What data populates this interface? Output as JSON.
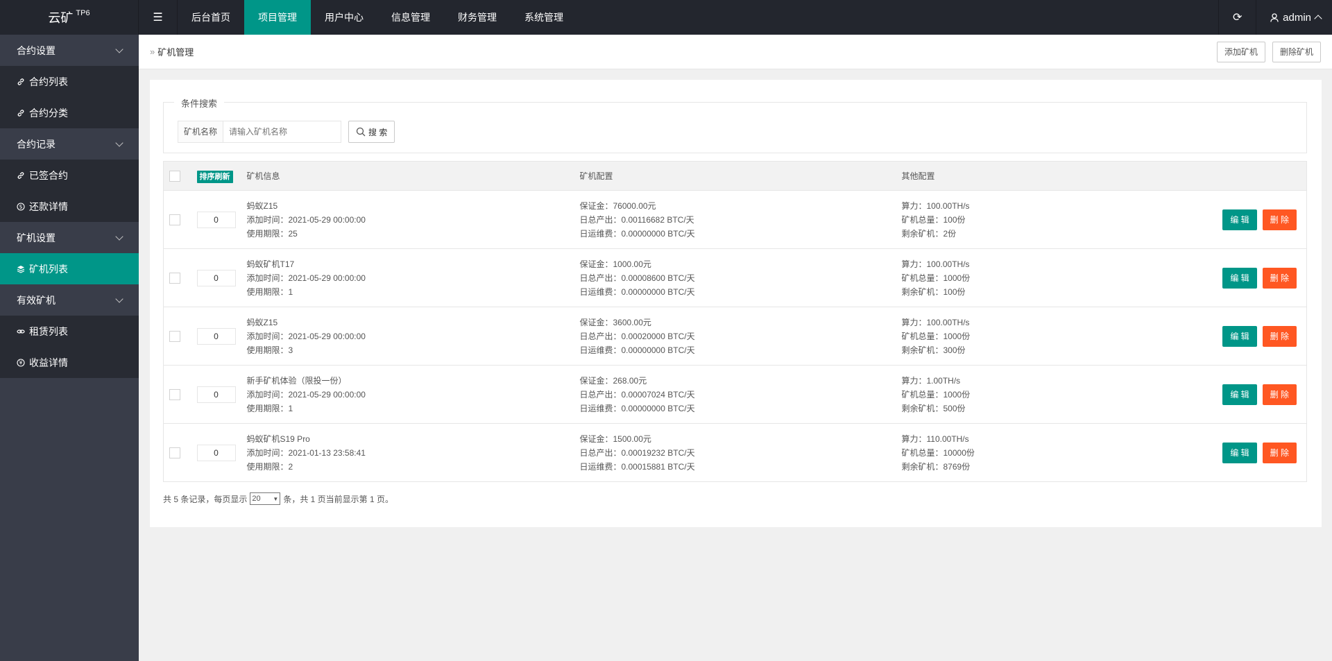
{
  "header": {
    "logo": "云矿",
    "logo_sup": "TP6",
    "nav": [
      "后台首页",
      "项目管理",
      "用户中心",
      "信息管理",
      "财务管理",
      "系统管理"
    ],
    "active_nav": 1,
    "user": "admin"
  },
  "sidebar": {
    "groups": [
      {
        "label": "合约设置",
        "items": [
          {
            "icon": "link-icon",
            "label": "合约列表"
          },
          {
            "icon": "link-icon",
            "label": "合约分类"
          }
        ]
      },
      {
        "label": "合约记录",
        "items": [
          {
            "icon": "link-icon",
            "label": "已签合约"
          },
          {
            "icon": "dollar-icon",
            "label": "还款详情"
          }
        ]
      },
      {
        "label": "矿机设置",
        "items": [
          {
            "icon": "layers-icon",
            "label": "矿机列表"
          }
        ]
      },
      {
        "label": "有效矿机",
        "items": [
          {
            "icon": "chain-icon",
            "label": "租赁列表"
          },
          {
            "icon": "yen-icon",
            "label": "收益详情"
          }
        ]
      }
    ]
  },
  "breadcrumb": "矿机管理",
  "toolbar": {
    "add_label": "添加矿机",
    "delete_label": "删除矿机"
  },
  "search": {
    "legend": "条件搜索",
    "label": "矿机名称",
    "placeholder": "请输入矿机名称",
    "button": "搜 索"
  },
  "table": {
    "headers": {
      "sort": "排序刷新",
      "info": "矿机信息",
      "config": "矿机配置",
      "other": "其他配置"
    },
    "rows": [
      {
        "sort": "0",
        "name": "蚂蚁Z15",
        "added": "添加时间：2021-05-29 00:00:00",
        "period": "使用期限：25",
        "deposit": "保证金：76000.00元",
        "daily": "日总产出：0.00116682 BTC/天",
        "maint": "日运维费：0.00000000 BTC/天",
        "power": "算力：100.00TH/s",
        "total": "矿机总量：100份",
        "remain": "剩余矿机：2份"
      },
      {
        "sort": "0",
        "name": "蚂蚁矿机T17",
        "added": "添加时间：2021-05-29 00:00:00",
        "period": "使用期限：1",
        "deposit": "保证金：1000.00元",
        "daily": "日总产出：0.00008600 BTC/天",
        "maint": "日运维费：0.00000000 BTC/天",
        "power": "算力：100.00TH/s",
        "total": "矿机总量：1000份",
        "remain": "剩余矿机：100份"
      },
      {
        "sort": "0",
        "name": "蚂蚁Z15",
        "added": "添加时间：2021-05-29 00:00:00",
        "period": "使用期限：3",
        "deposit": "保证金：3600.00元",
        "daily": "日总产出：0.00020000 BTC/天",
        "maint": "日运维费：0.00000000 BTC/天",
        "power": "算力：100.00TH/s",
        "total": "矿机总量：1000份",
        "remain": "剩余矿机：300份"
      },
      {
        "sort": "0",
        "name": "新手矿机体验（限投一份）",
        "added": "添加时间：2021-05-29 00:00:00",
        "period": "使用期限：1",
        "deposit": "保证金：268.00元",
        "daily": "日总产出：0.00007024 BTC/天",
        "maint": "日运维费：0.00000000 BTC/天",
        "power": "算力：1.00TH/s",
        "total": "矿机总量：1000份",
        "remain": "剩余矿机：500份"
      },
      {
        "sort": "0",
        "name": "蚂蚁矿机S19 Pro",
        "added": "添加时间：2021-01-13 23:58:41",
        "period": "使用期限：2",
        "deposit": "保证金：1500.00元",
        "daily": "日总产出：0.00019232 BTC/天",
        "maint": "日运维费：0.00015881 BTC/天",
        "power": "算力：110.00TH/s",
        "total": "矿机总量：10000份",
        "remain": "剩余矿机：8769份"
      }
    ],
    "edit_label": "编 辑",
    "delete_label": "删 除"
  },
  "pager": {
    "prefix": "共 5 条记录，每页显示",
    "per_page": "20",
    "suffix": "条，共 1 页当前显示第 1 页。"
  },
  "colors": {
    "accent": "#009688",
    "danger": "#ff5722",
    "header_bg": "#23262e",
    "sidebar_bg": "#393d49"
  }
}
